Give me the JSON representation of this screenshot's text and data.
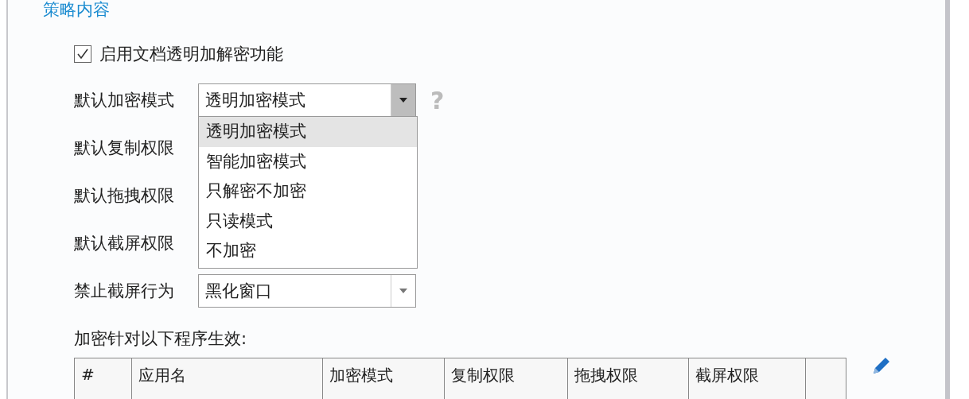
{
  "section_title": "策略内容",
  "enable_checkbox": {
    "label": "启用文档透明加解密功能",
    "checked": true
  },
  "settings": [
    {
      "label": "默认加密模式",
      "kind": "combo",
      "value": "透明加密模式",
      "help": "?"
    },
    {
      "label": "默认复制权限",
      "kind": "hidden"
    },
    {
      "label": "默认拖拽权限",
      "kind": "hidden"
    },
    {
      "label": "默认截屏权限",
      "kind": "hidden"
    },
    {
      "label": "禁止截屏行为",
      "kind": "combo",
      "value": "黑化窗口"
    }
  ],
  "dropdown_options": [
    {
      "label": "透明加密模式",
      "selected": true
    },
    {
      "label": "智能加密模式",
      "selected": false
    },
    {
      "label": "只解密不加密",
      "selected": false
    },
    {
      "label": "只读模式",
      "selected": false
    },
    {
      "label": "不加密",
      "selected": false
    }
  ],
  "programs_caption": "加密针对以下程序生效:",
  "table": {
    "columns": [
      "#",
      "应用名",
      "加密模式",
      "复制权限",
      "拖拽权限",
      "截屏权限"
    ]
  }
}
